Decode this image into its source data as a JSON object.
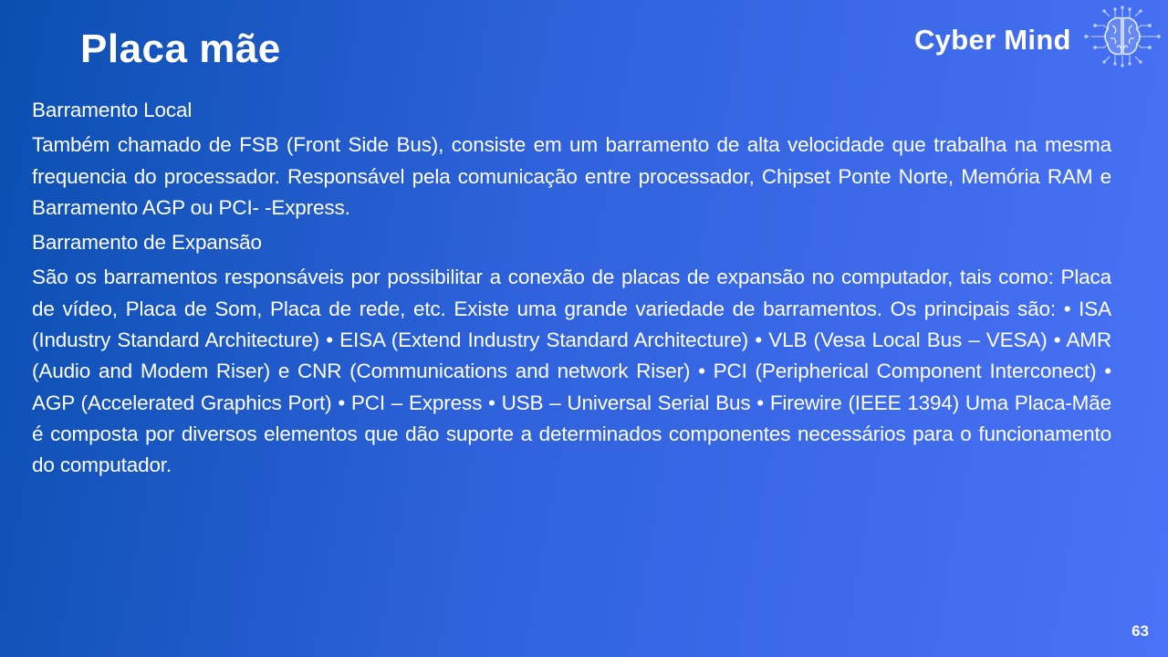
{
  "slide": {
    "title": "Placa mãe",
    "logo": {
      "text": "Cyber Mind",
      "icon": "brain-circuit-icon"
    },
    "paragraphs": [
      "Barramento Local",
      "Também chamado de FSB (Front Side Bus), consiste em um barramento de alta velocidade que trabalha na mesma frequencia do processador. Responsável pela comunicação entre processador, Chipset Ponte Norte, Memória RAM e Barramento AGP ou PCI- -Express.",
      "Barramento de Expansão",
      "São os barramentos responsáveis por possibilitar a conexão de placas de expansão no computador, tais como: Placa de vídeo, Placa de Som, Placa de rede, etc. Existe uma grande variedade de barramentos. Os principais são: • ISA (Industry Standard Architecture) • EISA (Extend Industry Standard Architecture) • VLB (Vesa Local Bus – VESA) • AMR (Audio and Modem Riser) e CNR (Communications and network Riser) • PCI (Peripherical Component Interconect) • AGP (Accelerated Graphics Port) • PCI – Express • USB – Universal Serial Bus • Firewire (IEEE 1394) Uma Placa-Mãe é composta por diversos elementos que dão suporte a determinados componentes necessários para o funcionamento do computador."
    ],
    "page_number": "63"
  }
}
